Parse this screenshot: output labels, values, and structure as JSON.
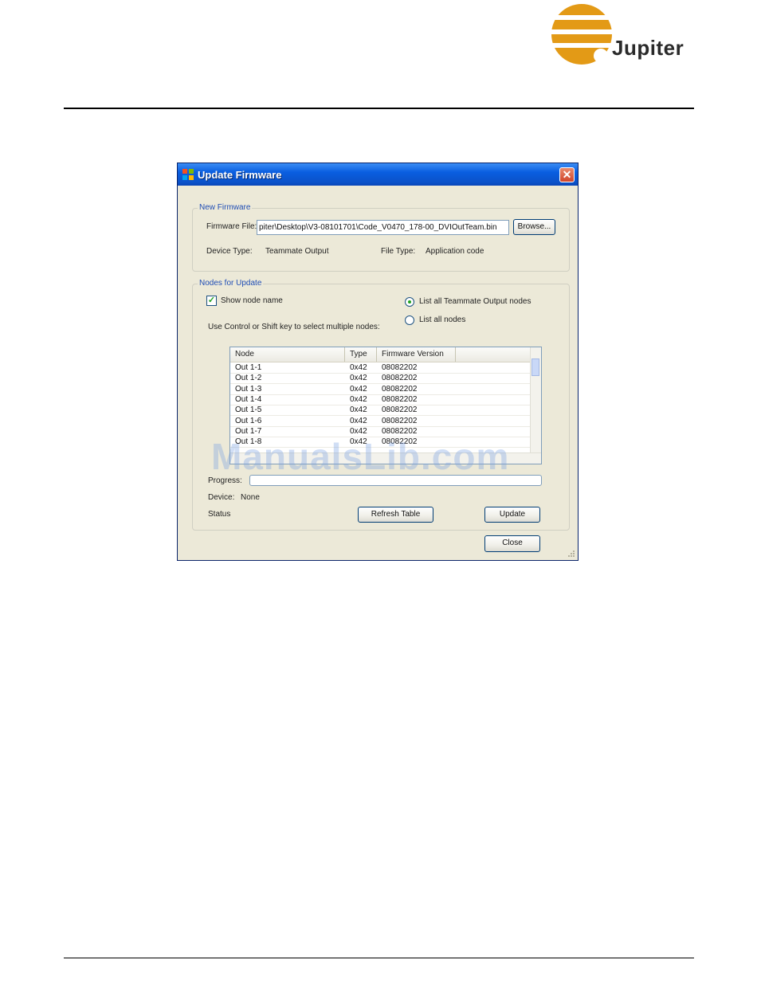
{
  "brand": {
    "name": "Jupiter",
    "colors": {
      "orange": "#e39a16",
      "text": "#2a2a2a"
    }
  },
  "window": {
    "title": "Update Firmware",
    "close_icon": "close-icon",
    "new_firmware": {
      "legend": "New Firmware",
      "firmware_file_label": "Firmware File:",
      "firmware_file_value": "piter\\Desktop\\V3-08101701\\Code_V0470_178-00_DVIOutTeam.bin",
      "browse_label": "Browse...",
      "device_type_label": "Device Type:",
      "device_type_value": "Teammate Output",
      "file_type_label": "File Type:",
      "file_type_value": "Application code"
    },
    "nodes": {
      "legend": "Nodes for Update",
      "show_node_name_label": "Show node name",
      "show_node_name_checked": true,
      "radio_teammate_label": "List all Teammate Output nodes",
      "radio_all_label": "List all nodes",
      "selected_radio": "teammate",
      "hint": "Use Control or Shift key to select multiple nodes:",
      "columns": [
        "Node",
        "Type",
        "Firmware Version"
      ],
      "rows": [
        [
          "Out 1-1",
          "0x42",
          "08082202"
        ],
        [
          "Out 1-2",
          "0x42",
          "08082202"
        ],
        [
          "Out 1-3",
          "0x42",
          "08082202"
        ],
        [
          "Out 1-4",
          "0x42",
          "08082202"
        ],
        [
          "Out 1-5",
          "0x42",
          "08082202"
        ],
        [
          "Out 1-6",
          "0x42",
          "08082202"
        ],
        [
          "Out 1-7",
          "0x42",
          "08082202"
        ],
        [
          "Out 1-8",
          "0x42",
          "08082202"
        ]
      ],
      "progress_label": "Progress:",
      "progress_fraction": 0,
      "device_label": "Device:",
      "device_value": "None",
      "status_label": "Status",
      "refresh_label": "Refresh Table",
      "update_label": "Update"
    },
    "close_label": "Close"
  },
  "watermark": "ManualsLib.com"
}
